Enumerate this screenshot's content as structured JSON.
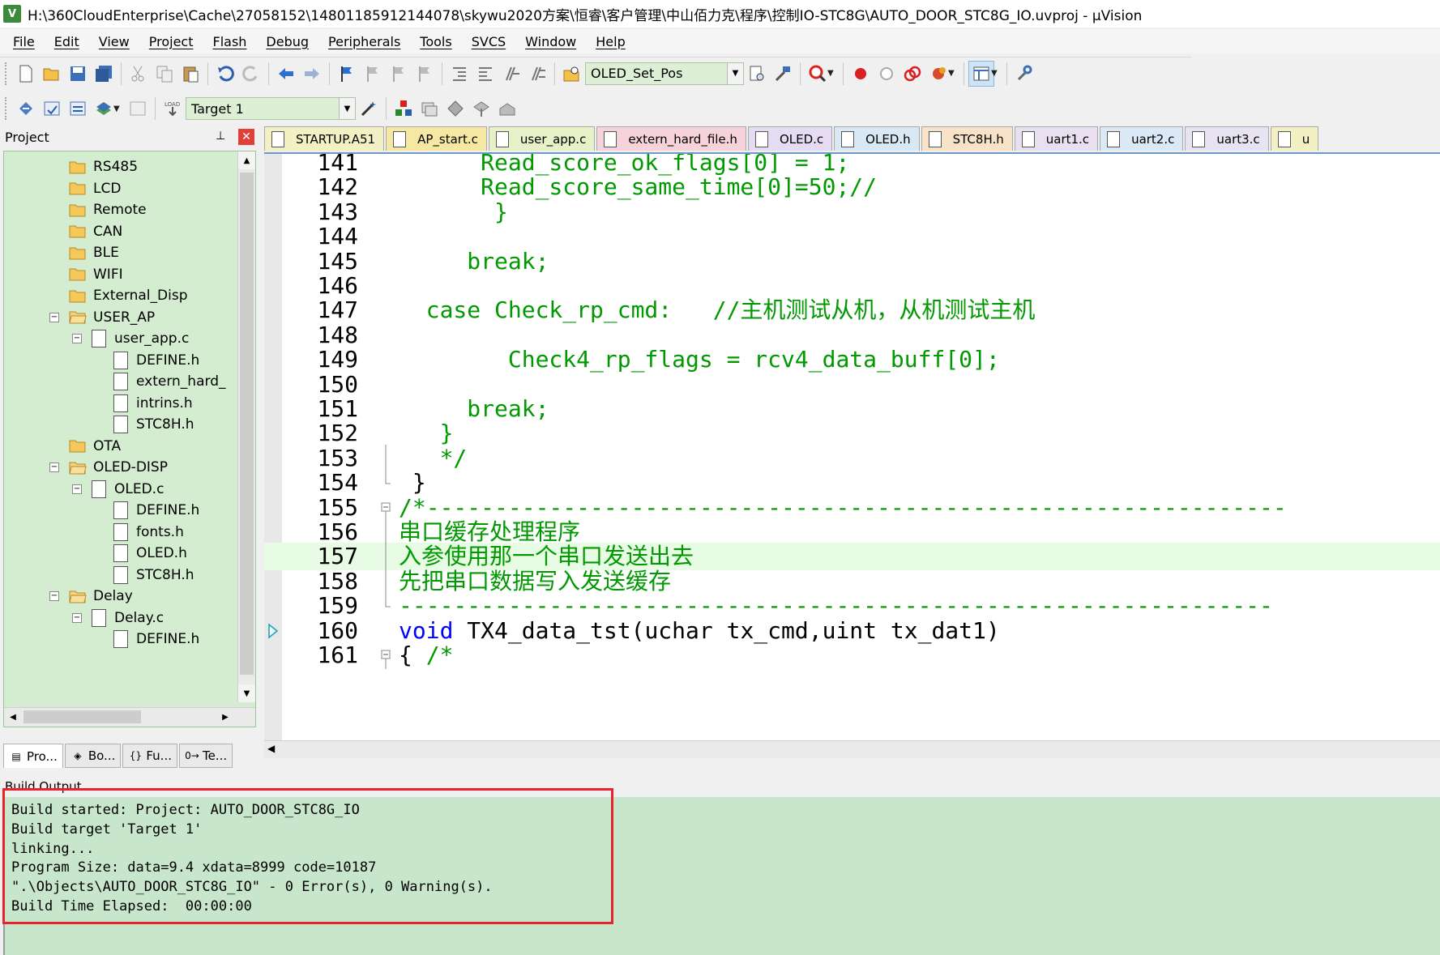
{
  "window": {
    "app_icon": "V",
    "title": "H:\\360CloudEnterprise\\Cache\\27058152\\14801185912144078\\skywu2020方案\\恒睿\\客户管理\\中山佰力克\\程序\\控制IO-STC8G\\AUTO_DOOR_STC8G_IO.uvproj - µVision"
  },
  "menu": [
    "File",
    "Edit",
    "View",
    "Project",
    "Flash",
    "Debug",
    "Peripherals",
    "Tools",
    "SVCS",
    "Window",
    "Help"
  ],
  "toolbar": {
    "function_combo": "OLED_Set_Pos",
    "target_combo": "Target 1"
  },
  "project_panel": {
    "title": "Project",
    "pin_glyph": "⊥",
    "close_glyph": "✕",
    "tree": [
      {
        "label": "RS485",
        "type": "folder",
        "level": 1,
        "toggle": ""
      },
      {
        "label": "LCD",
        "type": "folder",
        "level": 1,
        "toggle": ""
      },
      {
        "label": "Remote",
        "type": "folder",
        "level": 1,
        "toggle": ""
      },
      {
        "label": "CAN",
        "type": "folder",
        "level": 1,
        "toggle": ""
      },
      {
        "label": "BLE",
        "type": "folder",
        "level": 1,
        "toggle": ""
      },
      {
        "label": "WIFI",
        "type": "folder",
        "level": 1,
        "toggle": ""
      },
      {
        "label": "External_Disp",
        "type": "folder",
        "level": 1,
        "toggle": ""
      },
      {
        "label": "USER_AP",
        "type": "folder-open",
        "level": 1,
        "toggle": "−"
      },
      {
        "label": "user_app.c",
        "type": "file",
        "level": 2,
        "toggle": "−"
      },
      {
        "label": "DEFINE.h",
        "type": "file",
        "level": 3,
        "toggle": ""
      },
      {
        "label": "extern_hard_",
        "type": "file",
        "level": 3,
        "toggle": ""
      },
      {
        "label": "intrins.h",
        "type": "file",
        "level": 3,
        "toggle": ""
      },
      {
        "label": "STC8H.h",
        "type": "file",
        "level": 3,
        "toggle": ""
      },
      {
        "label": "OTA",
        "type": "folder",
        "level": 1,
        "toggle": ""
      },
      {
        "label": "OLED-DISP",
        "type": "folder-open",
        "level": 1,
        "toggle": "−"
      },
      {
        "label": "OLED.c",
        "type": "file",
        "level": 2,
        "toggle": "−"
      },
      {
        "label": "DEFINE.h",
        "type": "file",
        "level": 3,
        "toggle": ""
      },
      {
        "label": "fonts.h",
        "type": "file",
        "level": 3,
        "toggle": ""
      },
      {
        "label": "OLED.h",
        "type": "file",
        "level": 3,
        "toggle": ""
      },
      {
        "label": "STC8H.h",
        "type": "file",
        "level": 3,
        "toggle": ""
      },
      {
        "label": "Delay",
        "type": "folder-open",
        "level": 1,
        "toggle": "−"
      },
      {
        "label": "Delay.c",
        "type": "file",
        "level": 2,
        "toggle": "−"
      },
      {
        "label": "DEFINE.h",
        "type": "file",
        "level": 3,
        "toggle": ""
      }
    ],
    "tabs": [
      {
        "label": "Pro...",
        "icon": "project-tab-icon",
        "glyph": "▤"
      },
      {
        "label": "Bo...",
        "icon": "books-tab-icon",
        "glyph": "◈"
      },
      {
        "label": "Fu...",
        "icon": "functions-tab-icon",
        "glyph": "{}"
      },
      {
        "label": "Te...",
        "icon": "templates-tab-icon",
        "glyph": "0→"
      }
    ]
  },
  "editor": {
    "tabs": [
      {
        "label": "STARTUP.A51",
        "color": "#f3f0c4"
      },
      {
        "label": "AP_start.c",
        "color": "#f6e7a2"
      },
      {
        "label": "user_app.c",
        "color": "#e7f1c8"
      },
      {
        "label": "extern_hard_file.h",
        "color": "#f6d3da"
      },
      {
        "label": "OLED.c",
        "color": "#e5dcf3"
      },
      {
        "label": "OLED.h",
        "color": "#d8e8f4"
      },
      {
        "label": "STC8H.h",
        "color": "#f8e3c8"
      },
      {
        "label": "uart1.c",
        "color": "#e8dff1"
      },
      {
        "label": "uart2.c",
        "color": "#dbe8f5"
      },
      {
        "label": "uart3.c",
        "color": "#e8e3f3"
      },
      {
        "label": "u",
        "color": "#f3f0c4"
      }
    ],
    "lines": [
      {
        "no": "141",
        "indent": "      ",
        "text": "Read_score_ok_flags[0] = 1;",
        "color": "green",
        "fold": "",
        "hl": false
      },
      {
        "no": "142",
        "indent": "      ",
        "text": "Read_score_same_time[0]=50;//",
        "color": "green",
        "fold": "",
        "hl": false
      },
      {
        "no": "143",
        "indent": "       ",
        "text": "}",
        "color": "green",
        "fold": "",
        "hl": false
      },
      {
        "no": "144",
        "indent": "",
        "text": "",
        "color": "green",
        "fold": "",
        "hl": false
      },
      {
        "no": "145",
        "indent": "     ",
        "text": "break;",
        "color": "green",
        "fold": "",
        "hl": false
      },
      {
        "no": "146",
        "indent": "",
        "text": "",
        "color": "green",
        "fold": "",
        "hl": false
      },
      {
        "no": "147",
        "indent": "  ",
        "text": "case Check_rp_cmd:   //主机测试从机，从机测试主机",
        "color": "green",
        "fold": "",
        "hl": false
      },
      {
        "no": "148",
        "indent": "",
        "text": "",
        "color": "green",
        "fold": "",
        "hl": false
      },
      {
        "no": "149",
        "indent": "        ",
        "text": "Check4_rp_flags = rcv4_data_buff[0];",
        "color": "green",
        "fold": "",
        "hl": false
      },
      {
        "no": "150",
        "indent": "",
        "text": "",
        "color": "green",
        "fold": "",
        "hl": false
      },
      {
        "no": "151",
        "indent": "     ",
        "text": "break;",
        "color": "green",
        "fold": "",
        "hl": false
      },
      {
        "no": "152",
        "indent": "   ",
        "text": "}",
        "color": "green",
        "fold": "",
        "hl": false
      },
      {
        "no": "153",
        "indent": "   ",
        "text": "*/",
        "color": "green",
        "fold": "line",
        "hl": false
      },
      {
        "no": "154",
        "indent": " ",
        "text": "}",
        "color": "black",
        "fold": "end",
        "hl": false
      },
      {
        "no": "155",
        "indent": "",
        "text": "/*---------------------------------------------------------------",
        "color": "green",
        "fold": "minus",
        "hl": false
      },
      {
        "no": "156",
        "indent": "",
        "text": "串口缓存处理程序",
        "color": "green",
        "fold": "line",
        "hl": false
      },
      {
        "no": "157",
        "indent": "",
        "text": "入参使用那一个串口发送出去",
        "color": "green",
        "fold": "line",
        "hl": true
      },
      {
        "no": "158",
        "indent": "",
        "text": "先把串口数据写入发送缓存",
        "color": "green",
        "fold": "line",
        "hl": false
      },
      {
        "no": "159",
        "indent": "",
        "text": "----------------------------------------------------------------",
        "color": "green",
        "fold": "end",
        "hl": false
      },
      {
        "no": "160",
        "indent": "",
        "text": "void TX4_data_tst(uchar tx_cmd,uint tx_dat1)",
        "color": "mixed",
        "fold": "",
        "hl": false,
        "marker": true
      },
      {
        "no": "161",
        "indent": "",
        "text": "{ /*",
        "color": "mixed2",
        "fold": "minus",
        "hl": false
      }
    ]
  },
  "build_output": {
    "title": "Build Output",
    "lines": [
      "Build started: Project: AUTO_DOOR_STC8G_IO",
      "Build target 'Target 1'",
      "linking...",
      "Program Size: data=9.4 xdata=8999 code=10187",
      "\".\\Objects\\AUTO_DOOR_STC8G_IO\" - 0 Error(s), 0 Warning(s).",
      "Build Time Elapsed:  00:00:00"
    ]
  },
  "colors": {
    "accent": "#6b9ac7",
    "tree_bg": "#d4ecd0",
    "build_bg": "#c8e6cc",
    "code_green": "#009900",
    "code_blue": "#0000ff",
    "highlight_red": "#e8232a"
  }
}
